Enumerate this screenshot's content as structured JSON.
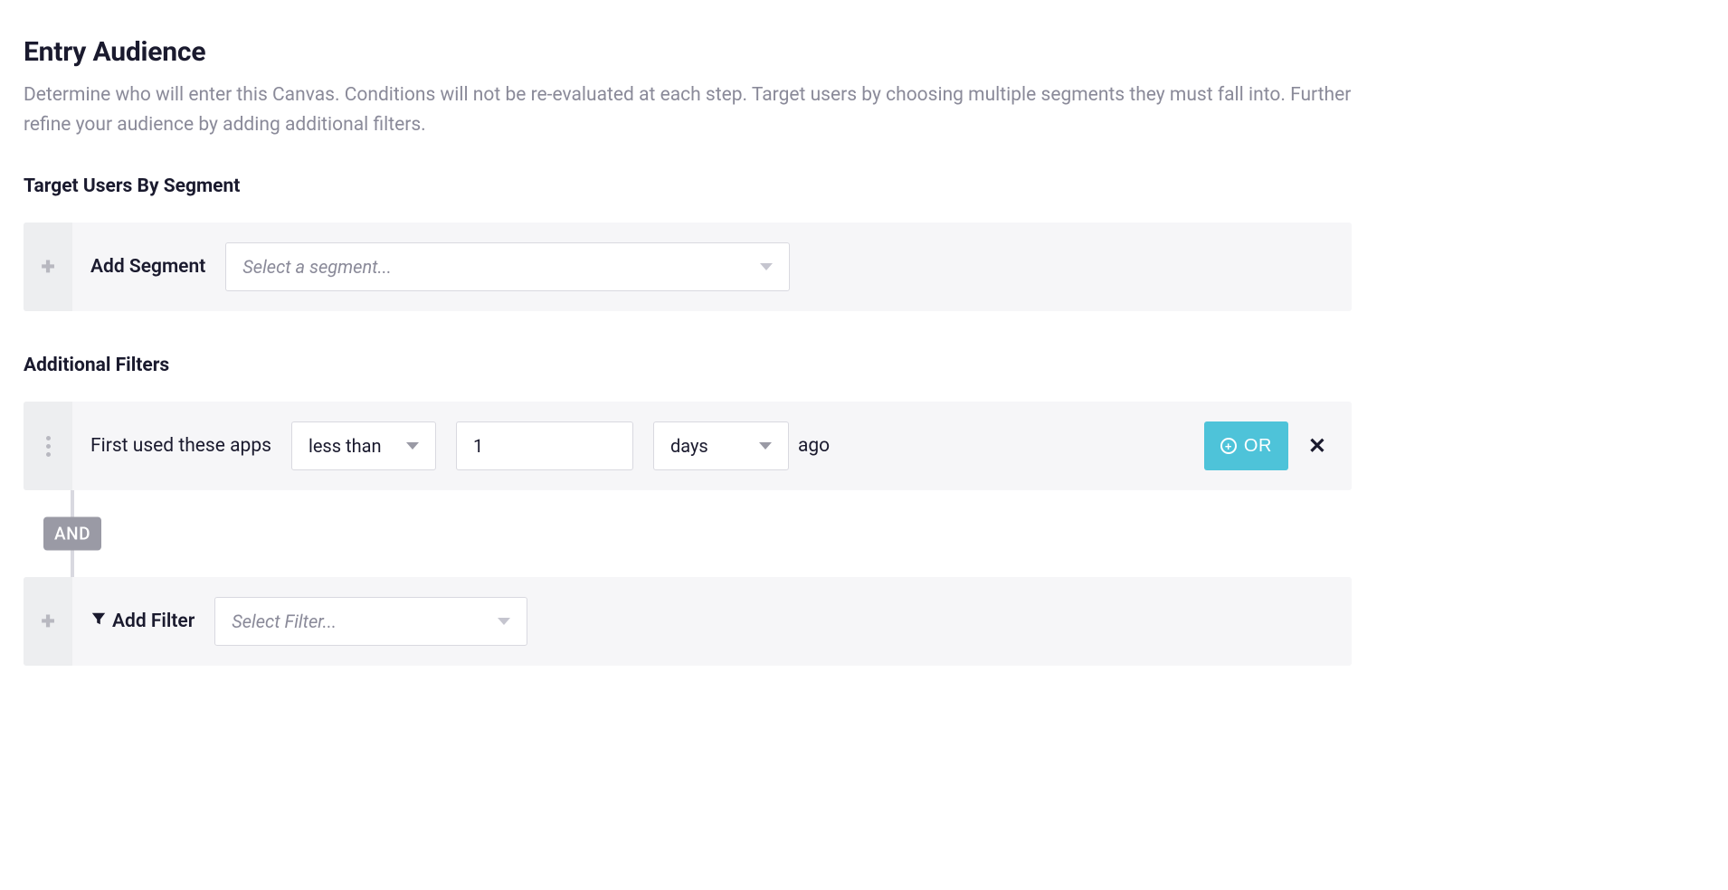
{
  "header": {
    "title": "Entry Audience",
    "description": "Determine who will enter this Canvas. Conditions will not be re-evaluated at each step. Target users by choosing multiple segments they must fall into. Further refine your audience by adding additional filters."
  },
  "segments": {
    "section_title": "Target Users By Segment",
    "add_label": "Add Segment",
    "select_placeholder": "Select a segment..."
  },
  "filters": {
    "section_title": "Additional Filters",
    "rows": [
      {
        "field_label": "First used these apps",
        "comparator": "less than",
        "value": "1",
        "unit": "days",
        "suffix": "ago"
      }
    ],
    "or_label": "OR",
    "and_label": "AND",
    "add_filter_label": "Add Filter",
    "add_filter_placeholder": "Select Filter..."
  }
}
